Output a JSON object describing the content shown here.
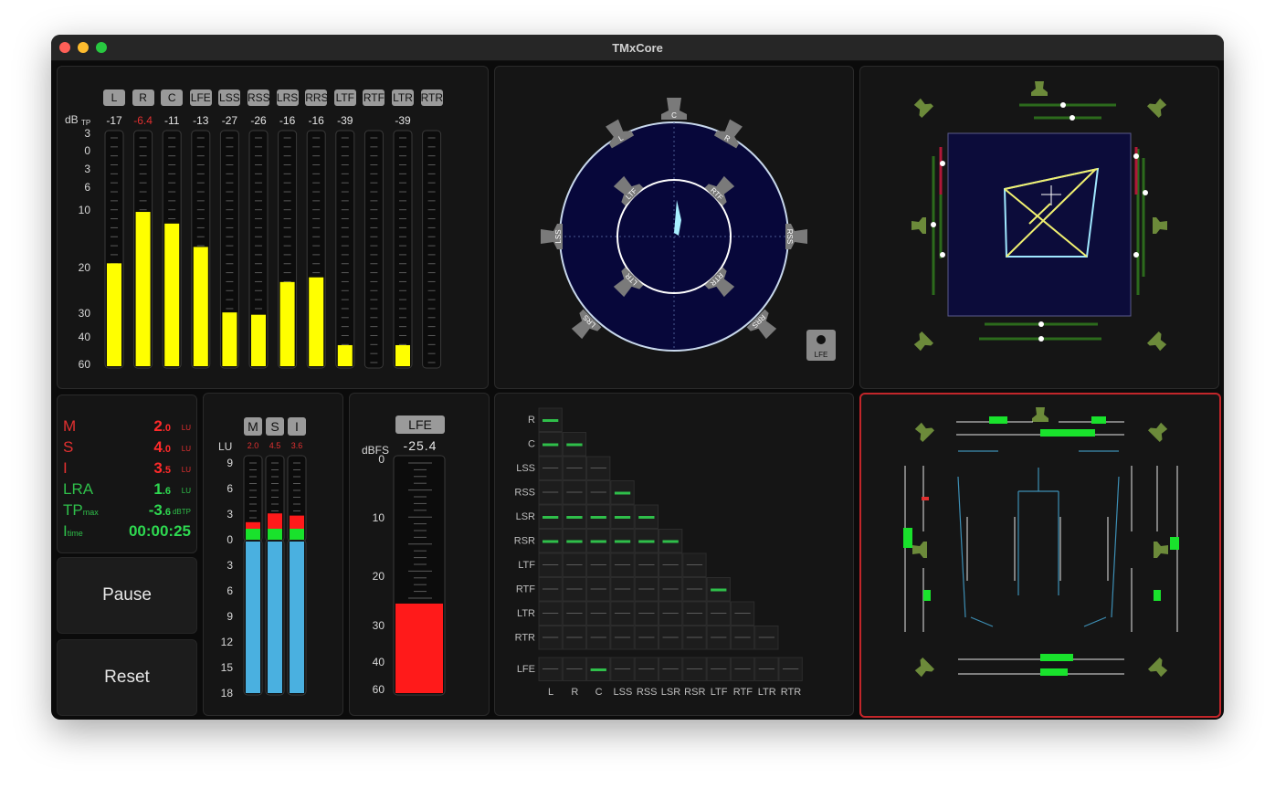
{
  "window": {
    "title": "TMxCore"
  },
  "colors": {
    "meter_yellow": "#ffff00",
    "meter_red": "#ff1a1a",
    "meter_blue": "#4ab0e0",
    "loud_green": "#2fbf4a",
    "bright_green": "#19e22c",
    "accent_red": "#e23030"
  },
  "peak_meter": {
    "unit_label": "dB",
    "unit_sub": "TP",
    "scale": [
      "3",
      "0",
      "3",
      "6",
      "10",
      "20",
      "30",
      "40",
      "60"
    ],
    "channels": [
      {
        "name": "L",
        "peak": "-17",
        "level": 0.44
      },
      {
        "name": "R",
        "peak": "-6.4",
        "level": 0.66,
        "over": true
      },
      {
        "name": "C",
        "peak": "-11",
        "level": 0.61
      },
      {
        "name": "LFE",
        "peak": "-13",
        "level": 0.51
      },
      {
        "name": "LSS",
        "peak": "-27",
        "level": 0.23
      },
      {
        "name": "RSS",
        "peak": "-26",
        "level": 0.22
      },
      {
        "name": "LRS",
        "peak": "-16",
        "level": 0.36
      },
      {
        "name": "RRS",
        "peak": "-16",
        "level": 0.38
      },
      {
        "name": "LTF",
        "peak": "-39",
        "level": 0.09
      },
      {
        "name": "RTF",
        "peak": "",
        "level": 0.0
      },
      {
        "name": "LTR",
        "peak": "-39",
        "level": 0.09
      },
      {
        "name": "RTR",
        "peak": "",
        "level": 0.0
      }
    ]
  },
  "vector_scope": {
    "speakers": [
      "L",
      "C",
      "R",
      "LTF",
      "RTF",
      "LSS",
      "RSS",
      "LTR",
      "RTR",
      "LRS",
      "RRS"
    ],
    "lfe_label": "LFE"
  },
  "loudness": {
    "rows": [
      {
        "label": "M",
        "sub": "",
        "value": "2",
        "frac": ".0",
        "unit": "LU",
        "color": "red"
      },
      {
        "label": "S",
        "sub": "",
        "value": "4",
        "frac": ".0",
        "unit": "LU",
        "color": "red"
      },
      {
        "label": "I",
        "sub": "",
        "value": "3",
        "frac": ".5",
        "unit": "LU",
        "color": "red"
      },
      {
        "label": "LRA",
        "sub": "",
        "value": "1",
        "frac": ".6",
        "unit": "LU",
        "color": "green"
      },
      {
        "label": "TP",
        "sub": "max",
        "value": "-3",
        "frac": ".6",
        "unit": "dBTP",
        "color": "green"
      },
      {
        "label": "I",
        "sub": "time",
        "value": "00:00:25",
        "frac": "",
        "unit": "",
        "color": "green"
      }
    ]
  },
  "controls": {
    "pause": "Pause",
    "reset": "Reset"
  },
  "msi_meter": {
    "unit": "LU",
    "buttons": [
      "M",
      "S",
      "I"
    ],
    "peaks": [
      "2.0",
      "4.5",
      "3.6"
    ],
    "scale": [
      "9",
      "6",
      "3",
      "0",
      "3",
      "6",
      "9",
      "12",
      "15",
      "18"
    ],
    "bars": [
      {
        "red": 0.08,
        "blue": 0.66
      },
      {
        "red": 0.12,
        "blue": 0.66
      },
      {
        "red": 0.11,
        "blue": 0.66
      }
    ]
  },
  "lfe_meter": {
    "button": "LFE",
    "unit": "dBFS",
    "value": "-25.4",
    "level": 0.38,
    "scale": [
      "0",
      "10",
      "20",
      "30",
      "40",
      "60"
    ]
  },
  "correlation": {
    "rows": [
      "R",
      "C",
      "LSS",
      "RSS",
      "LSR",
      "RSR",
      "LTF",
      "RTF",
      "LTR",
      "RTR",
      "LFE"
    ],
    "cols": [
      "L",
      "R",
      "C",
      "LSS",
      "RSS",
      "LSR",
      "RSR",
      "LTF",
      "RTF",
      "LTR",
      "RTR"
    ]
  }
}
